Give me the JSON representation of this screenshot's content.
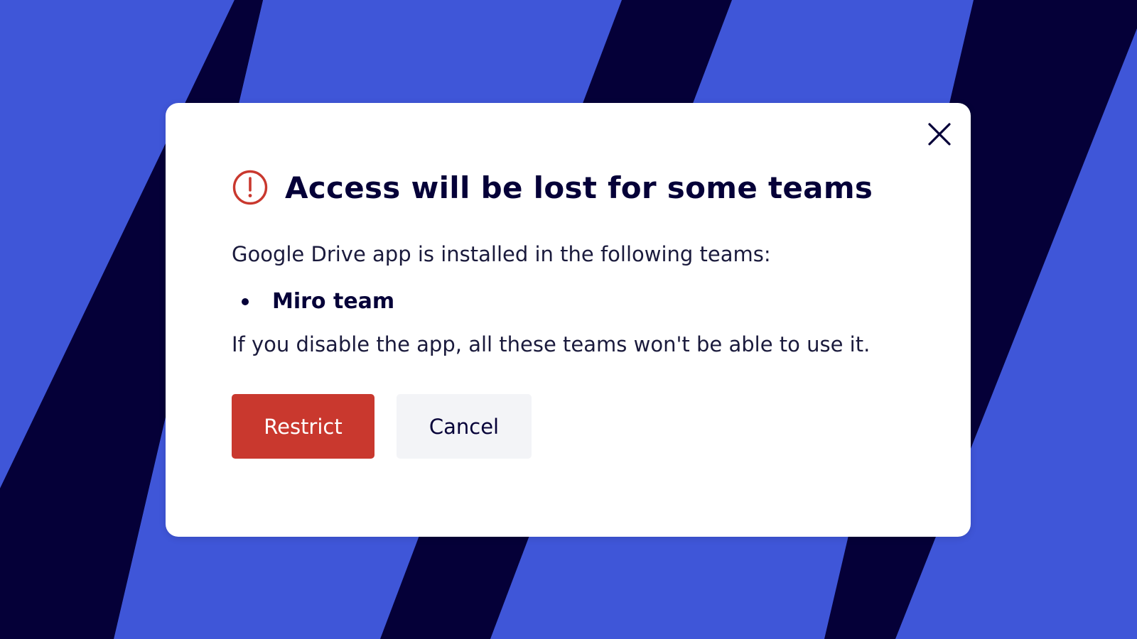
{
  "colors": {
    "background_blue": "#3f56d8",
    "background_stripe": "#050038",
    "modal_background": "#ffffff",
    "danger": "#c9382e",
    "text_primary": "#050038",
    "cancel_background": "#f3f4f7"
  },
  "dialog": {
    "title": "Access will be lost for some teams",
    "alert_icon": "alert-circle-icon",
    "close_icon": "close-icon",
    "intro_text": "Google Drive app is installed in the following teams:",
    "teams": [
      "Miro team"
    ],
    "warning_text": "If you disable the app, all these teams won't be able to use it.",
    "buttons": {
      "restrict_label": "Restrict",
      "cancel_label": "Cancel"
    }
  }
}
